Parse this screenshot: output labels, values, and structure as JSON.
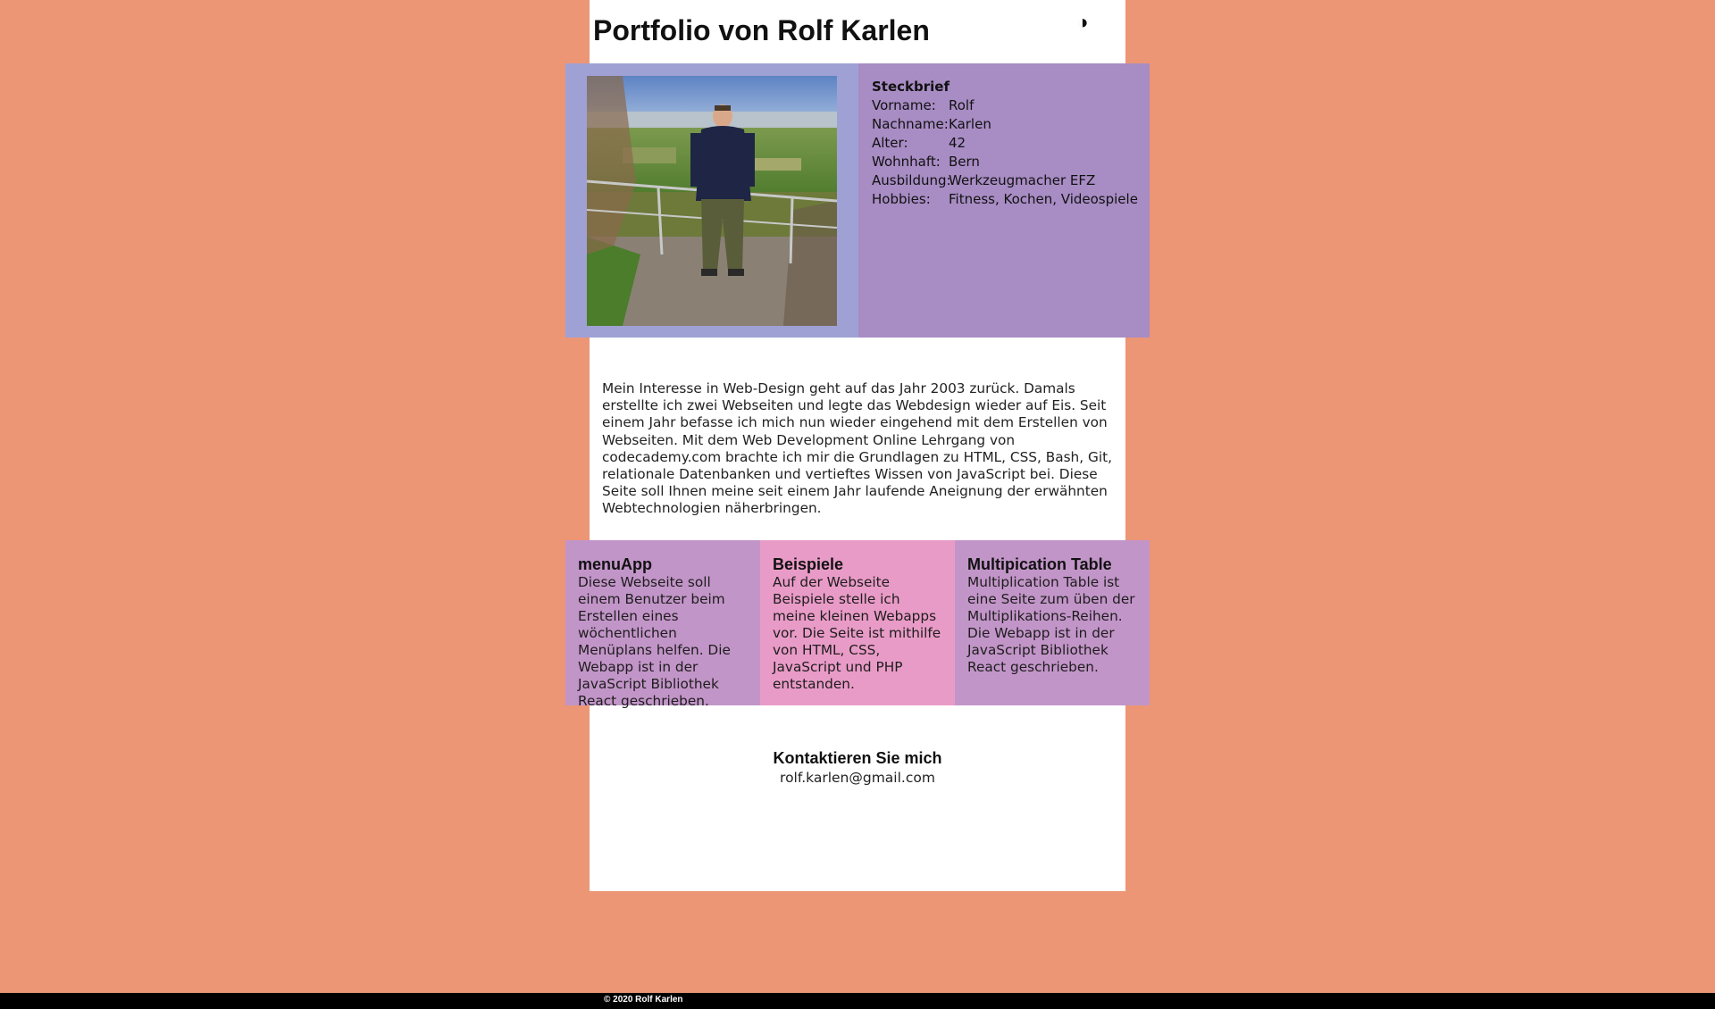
{
  "header": {
    "title": "Portfolio von Rolf Karlen",
    "theme_toggle_icon": "◑"
  },
  "profile": {
    "photo_alt": "Rolf Karlen",
    "steckbrief_title": "Steckbrief",
    "rows": [
      {
        "label": "Vorname:",
        "value": "Rolf"
      },
      {
        "label": "Nachname:",
        "value": "Karlen"
      },
      {
        "label": "Alter:",
        "value": "42"
      },
      {
        "label": "Wohnhaft:",
        "value": "Bern"
      },
      {
        "label": "Ausbildung:",
        "value": "Werkzeugmacher EFZ"
      },
      {
        "label": "Hobbies:",
        "value": "Fitness, Kochen, Videospiele"
      }
    ]
  },
  "intro": {
    "text": "Mein Interesse in Web-Design geht auf das Jahr 2003 zurück. Damals erstellte ich zwei Webseiten und legte das Webdesign wieder auf Eis. Seit einem Jahr befasse ich mich nun wieder eingehend mit dem Erstellen von Webseiten. Mit dem Web Development Online Lehrgang von codecademy.com brachte ich mir die Grundlagen zu HTML, CSS, Bash, Git, relationale Datenbanken und vertieftes Wissen von JavaScript bei. Diese Seite soll Ihnen meine seit einem Jahr laufende Aneignung der erwähnten Webtechnologien näherbringen."
  },
  "projects": [
    {
      "title": "menuApp",
      "text": "Diese Webseite soll einem Benutzer beim Erstellen eines wöchentlichen Menüplans helfen. Die Webapp ist in der JavaScript Bibliothek React geschrieben."
    },
    {
      "title": "Beispiele",
      "text": "Auf der Webseite Beispiele stelle ich meine kleinen Webapps vor. Die Seite ist mithilfe von HTML, CSS, JavaScript und PHP entstanden."
    },
    {
      "title": "Multipication Table",
      "text": "Multiplication Table ist eine Seite zum üben der Multiplikations-Reihen. Die Webapp ist in der JavaScript Bibliothek React geschrieben."
    }
  ],
  "contact": {
    "title": "Kontaktieren Sie mich",
    "email": "rolf.karlen@gmail.com"
  },
  "footer": {
    "copyright": "© 2020 Rolf Karlen"
  },
  "colors": {
    "background": "#ec9676",
    "photo_panel": "#9fa1d5",
    "steckbrief_panel": "#a88cc4",
    "project_purple": "#c295c8",
    "project_pink": "#e99bc7"
  }
}
